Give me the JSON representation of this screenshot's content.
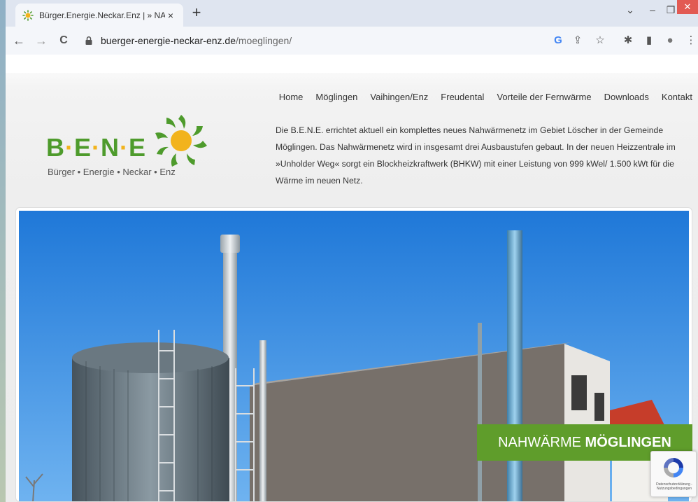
{
  "browser": {
    "tab_title": "Bürger.Energie.Neckar.Enz | » NA",
    "tab_close": "×",
    "new_tab": "+",
    "url_host": "buerger-energie-neckar-enz.de",
    "url_path": "/moeglingen/",
    "window_controls": {
      "minimize": "–",
      "restore": "❐",
      "close": "✕"
    },
    "nav": {
      "back": "←",
      "forward": "→",
      "reload": "C"
    },
    "toolbar_icons": {
      "google": "G",
      "share": "⇪",
      "star": "☆",
      "extensions": "✱",
      "sidepanel": "▮",
      "profile": "●",
      "menu": "⋮"
    }
  },
  "site": {
    "nav_items": [
      "Home",
      "Möglingen",
      "Vaihingen/Enz",
      "Freudental",
      "Vorteile der Fernwärme",
      "Downloads",
      "Kontakt"
    ],
    "logo": {
      "letters": [
        "B",
        "E",
        "N",
        "E"
      ],
      "tagline": "Bürger • Energie • Neckar • Enz"
    },
    "intro": "Die B.E.N.E. errichtet aktuell ein komplettes neues Nahwärmenetz im Gebiet Löscher in der Gemeinde Möglingen. Das Nahwärmenetz wird in insgesamt drei Ausbaustufen gebaut. In der neuen Heizzentrale im »Unholder Weg« sorgt ein Blockheizkraftwerk (BHKW) mit einer Leistung von 999 kWel/ 1.500 kWt für die Wärme im neuen Netz.",
    "badge_light": "NAHWÄRME ",
    "badge_bold": "MÖGLINGEN",
    "recaptcha_text": "Datenschutzerklärung - Nutzungsbedingungen"
  },
  "colors": {
    "brand_green": "#5f9d2b",
    "sun_yellow": "#f2b31c",
    "sky": "#3a8fe0"
  }
}
